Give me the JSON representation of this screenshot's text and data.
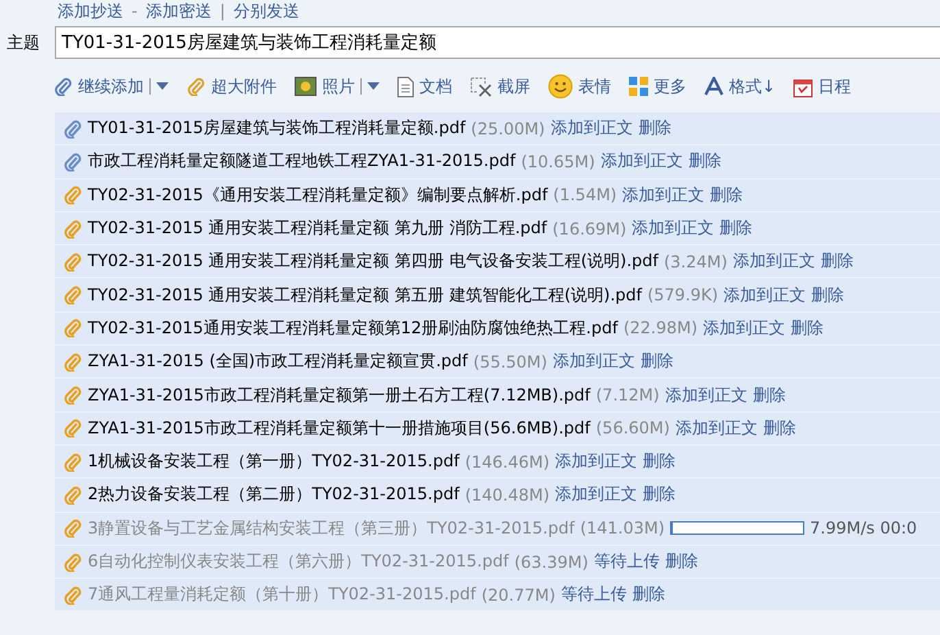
{
  "header_links": [
    "添加抄送",
    "-",
    "添加密送",
    "|",
    "分别发送"
  ],
  "subject": {
    "label": "主题",
    "value": "TY01-31-2015房屋建筑与装饰工程消耗量定额"
  },
  "toolbar": [
    {
      "kind": "clip",
      "label": "继续添加",
      "dropdown": true
    },
    {
      "kind": "bigclip",
      "label": "超大附件",
      "dropdown": false
    },
    {
      "kind": "photo",
      "label": "照片",
      "dropdown": true
    },
    {
      "kind": "doc",
      "label": "文档",
      "dropdown": false
    },
    {
      "kind": "scissors",
      "label": "截屏",
      "dropdown": false
    },
    {
      "kind": "smile",
      "label": "表情",
      "dropdown": false
    },
    {
      "kind": "grid",
      "label": "更多",
      "dropdown": false
    },
    {
      "kind": "font",
      "label": "格式↓",
      "dropdown": false
    },
    {
      "kind": "calendar",
      "label": "日程",
      "dropdown": false
    }
  ],
  "attachments": [
    {
      "color": "#6a8cc8",
      "kind": "done",
      "name": "TY01-31-2015房屋建筑与装饰工程消耗量定额.pdf",
      "size": "(25.00M)",
      "insert": "添加到正文",
      "delete": "删除"
    },
    {
      "color": "#6a8cc8",
      "kind": "done",
      "name": "市政工程消耗量定额隧道工程地铁工程ZYA1-31-2015.pdf",
      "size": "(10.65M)",
      "insert": "添加到正文",
      "delete": "删除"
    },
    {
      "color": "#e8a020",
      "kind": "done",
      "name": "TY02-31-2015《通用安装工程消耗量定额》编制要点解析.pdf",
      "size": "(1.54M)",
      "insert": "添加到正文",
      "delete": "删除"
    },
    {
      "color": "#e8a020",
      "kind": "done",
      "name": "TY02-31-2015 通用安装工程消耗量定额 第九册 消防工程.pdf",
      "size": "(16.69M)",
      "insert": "添加到正文",
      "delete": "删除"
    },
    {
      "color": "#e8a020",
      "kind": "done",
      "name": "TY02-31-2015 通用安装工程消耗量定额 第四册 电气设备安装工程(说明).pdf",
      "size": "(3.24M)",
      "insert": "添加到正文",
      "delete": "删除"
    },
    {
      "color": "#e8a020",
      "kind": "done",
      "name": "TY02-31-2015 通用安装工程消耗量定额 第五册 建筑智能化工程(说明).pdf",
      "size": "(579.9K)",
      "insert": "添加到正文",
      "delete": "删除"
    },
    {
      "color": "#e8a020",
      "kind": "done",
      "name": "TY02-31-2015通用安装工程消耗量定额第12册刷油防腐蚀绝热工程.pdf",
      "size": "(22.98M)",
      "insert": "添加到正文",
      "delete": "删除"
    },
    {
      "color": "#e8a020",
      "kind": "done",
      "name": "ZYA1-31-2015 (全国)市政工程消耗量定额宣贯.pdf",
      "size": "(55.50M)",
      "insert": "添加到正文",
      "delete": "删除"
    },
    {
      "color": "#e8a020",
      "kind": "done",
      "name": "ZYA1-31-2015市政工程消耗量定额第一册土石方工程(7.12MB).pdf",
      "size": "(7.12M)",
      "insert": "添加到正文",
      "delete": "删除"
    },
    {
      "color": "#e8a020",
      "kind": "done",
      "name": "ZYA1-31-2015市政工程消耗量定额第十一册措施项目(56.6MB).pdf",
      "size": "(56.60M)",
      "insert": "添加到正文",
      "delete": "删除"
    },
    {
      "color": "#e8a020",
      "kind": "done",
      "name": "1机械设备安装工程（第一册）TY02-31-2015.pdf",
      "size": "(146.46M)",
      "insert": "添加到正文",
      "delete": "删除"
    },
    {
      "color": "#e8a020",
      "kind": "done",
      "name": "2热力设备安装工程（第二册）TY02-31-2015.pdf",
      "size": "(140.48M)",
      "insert": "添加到正文",
      "delete": "删除"
    },
    {
      "color": "#e8a020",
      "kind": "uploading",
      "name": "3静置设备与工艺金属结构安装工程（第三册）TY02-31-2015.pdf",
      "size": "(141.03M)",
      "level": 0.01,
      "speed": "7.99M/s 00:0"
    },
    {
      "color": "#e8a020",
      "kind": "waiting",
      "name": "6自动化控制仪表安装工程（第六册）TY02-31-2015.pdf",
      "size": "(63.39M)",
      "state_text": "等待上传",
      "delete": "删除"
    },
    {
      "color": "#e8a020",
      "kind": "waiting",
      "name": "7通风工程量消耗定额（第十册）TY02-31-2015.pdf",
      "size": "(20.77M)",
      "state_text": "等待上传",
      "delete": "删除"
    }
  ]
}
